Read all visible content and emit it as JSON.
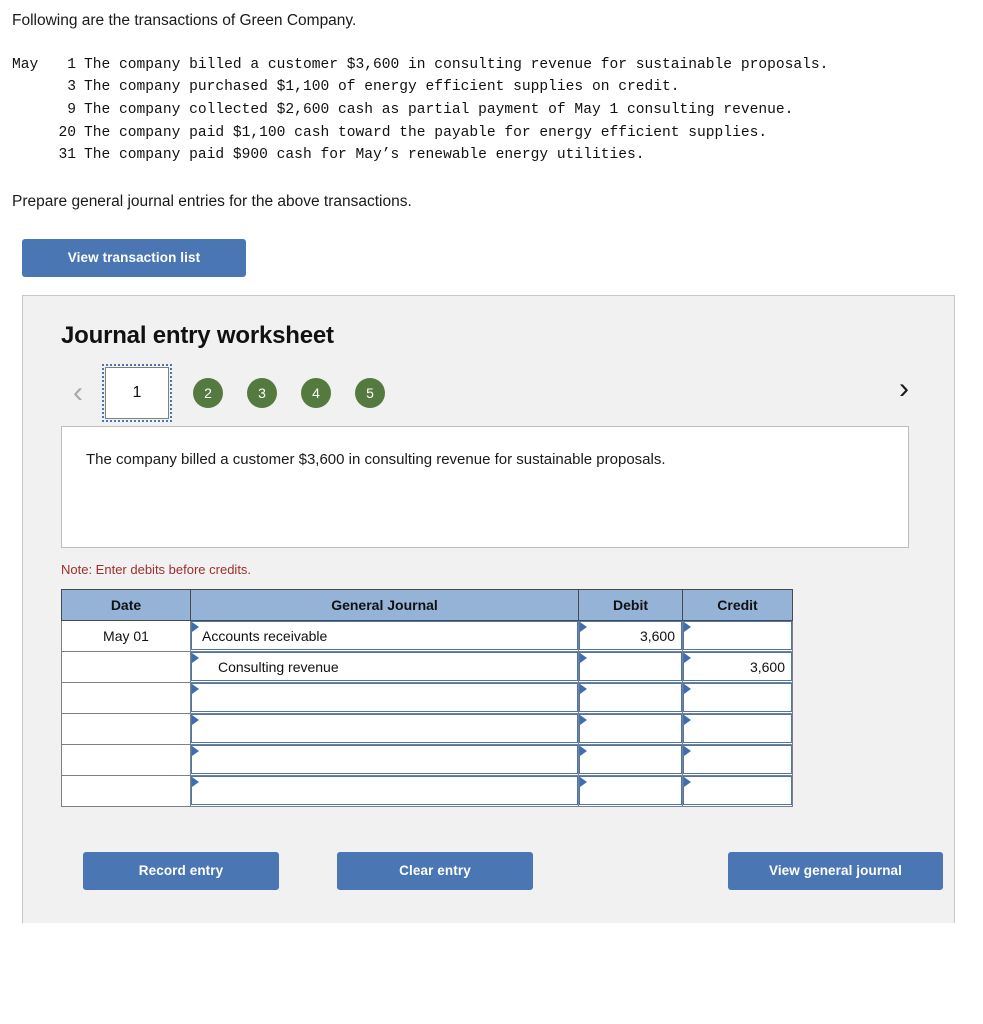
{
  "intro": {
    "heading": "Following are the transactions of Green Company."
  },
  "transactions": {
    "month_label": "May",
    "rows": [
      {
        "month": "May",
        "day": "1",
        "description": "The company billed a customer $3,600 in consulting revenue for sustainable proposals."
      },
      {
        "month": "",
        "day": "3",
        "description": "The company purchased $1,100 of energy efficient supplies on credit."
      },
      {
        "month": "",
        "day": "9",
        "description": "The company collected $2,600 cash as partial payment of May 1 consulting revenue."
      },
      {
        "month": "",
        "day": "20",
        "description": "The company paid $1,100 cash toward the payable for energy efficient supplies."
      },
      {
        "month": "",
        "day": "31",
        "description": "The company paid $900 cash for May’s renewable energy utilities."
      }
    ]
  },
  "prompt": {
    "text": "Prepare general journal entries for the above transactions."
  },
  "toolbar": {
    "view_transaction_list_label": "View transaction list"
  },
  "worksheet": {
    "title": "Journal entry worksheet",
    "pager": {
      "prev_icon": "‹",
      "next_icon": "›",
      "current_tab": "1",
      "tabs": [
        "2",
        "3",
        "4",
        "5"
      ]
    },
    "description": "The company billed a customer $3,600 in consulting revenue for sustainable proposals.",
    "note": "Note: Enter debits before credits.",
    "table": {
      "headers": [
        "Date",
        "General Journal",
        "Debit",
        "Credit"
      ],
      "rows": [
        {
          "date": "May 01",
          "account": "Accounts receivable",
          "indent": false,
          "debit": "3,600",
          "credit": ""
        },
        {
          "date": "",
          "account": "Consulting revenue",
          "indent": true,
          "debit": "",
          "credit": "3,600"
        },
        {
          "date": "",
          "account": "",
          "indent": false,
          "debit": "",
          "credit": ""
        },
        {
          "date": "",
          "account": "",
          "indent": false,
          "debit": "",
          "credit": ""
        },
        {
          "date": "",
          "account": "",
          "indent": false,
          "debit": "",
          "credit": ""
        },
        {
          "date": "",
          "account": "",
          "indent": false,
          "debit": "",
          "credit": ""
        }
      ]
    },
    "buttons": {
      "record_entry": "Record entry",
      "clear_entry": "Clear entry",
      "view_general_journal": "View general journal"
    }
  },
  "colors": {
    "button_blue": "#4a77b4",
    "tab_green": "#547a3f",
    "table_header_blue": "#95b3d7",
    "note_red": "#9f2d2d",
    "panel_bg": "#f1f1f1",
    "input_border_blue": "#4a77b4"
  }
}
